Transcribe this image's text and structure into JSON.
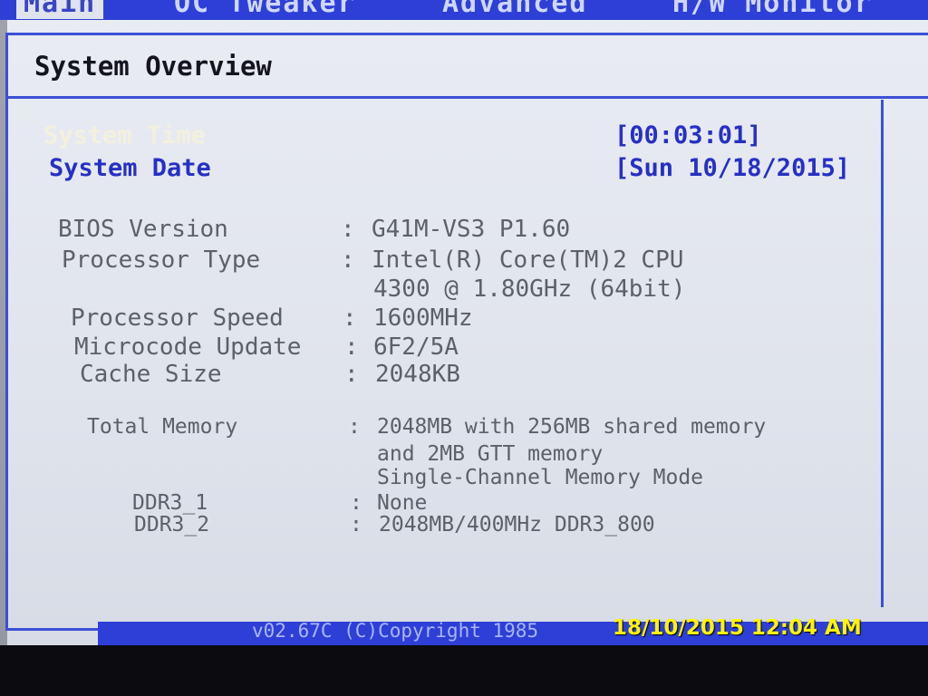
{
  "tabs": [
    {
      "label": "Main"
    },
    {
      "label": "OC Tweaker"
    },
    {
      "label": "Advanced"
    },
    {
      "label": "H/W Monitor"
    }
  ],
  "page_title": "System Overview",
  "system_time": {
    "label": "System Time",
    "value": "[00:03:01]"
  },
  "system_date": {
    "label": "System Date",
    "value": "[Sun 10/18/2015]"
  },
  "info": {
    "bios_label": "BIOS Version",
    "bios_value": "G41M-VS3 P1.60",
    "processor_type_label": "Processor Type",
    "processor_type_line1": "Intel(R) Core(TM)2 CPU",
    "processor_type_line2": "4300  @ 1.80GHz (64bit)",
    "processor_speed_label": "Processor Speed",
    "processor_speed_value": "1600MHz",
    "microcode_label": "Microcode Update",
    "microcode_value": "6F2/5A",
    "cache_label": "Cache Size",
    "cache_value": "2048KB",
    "total_memory_label": "Total Memory",
    "total_memory_line1": "2048MB with 256MB shared memory",
    "total_memory_line2": "and 2MB GTT memory",
    "total_memory_line3": "Single-Channel Memory Mode",
    "ddr3_1_label": "DDR3_1",
    "ddr3_1_value": "None",
    "ddr3_2_label": "DDR3_2",
    "ddr3_2_value": "2048MB/400MHz DDR3_800"
  },
  "separator": ":",
  "footer": "v02.67C  (C)Copyright 1985",
  "timestamp": "18/10/2015 12:04 AM",
  "colors": {
    "accent": "#2e3fd8",
    "selected": "#f4f0e0",
    "value": "#2630c4",
    "timestamp": "#fff400"
  }
}
